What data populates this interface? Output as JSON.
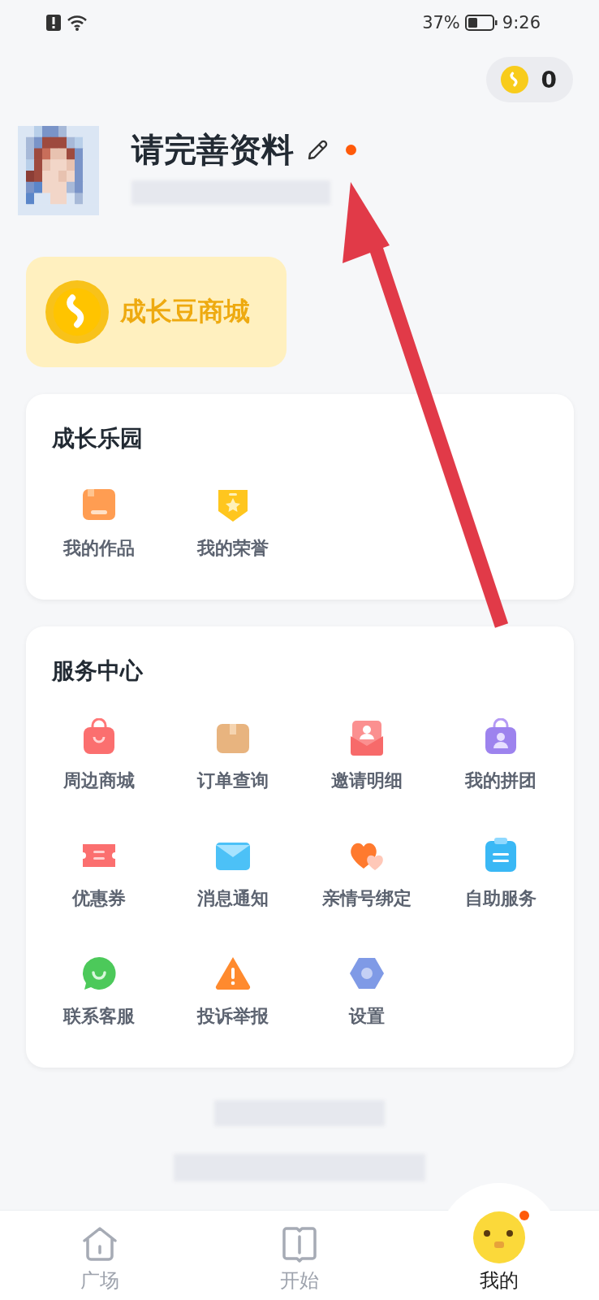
{
  "status_bar": {
    "battery": "37%",
    "time": "9:26"
  },
  "coins": {
    "count": "0"
  },
  "profile": {
    "title": "请完善资料",
    "unread_dot": true
  },
  "mall_card": {
    "label": "成长豆商城"
  },
  "sections": [
    {
      "title": "成长乐园",
      "items": [
        {
          "label": "我的作品"
        },
        {
          "label": "我的荣誉"
        }
      ]
    },
    {
      "title": "服务中心",
      "items": [
        {
          "label": "周边商城"
        },
        {
          "label": "订单查询"
        },
        {
          "label": "邀请明细"
        },
        {
          "label": "我的拼团"
        },
        {
          "label": "优惠券"
        },
        {
          "label": "消息通知"
        },
        {
          "label": "亲情号绑定"
        },
        {
          "label": "自助服务"
        },
        {
          "label": "联系客服"
        },
        {
          "label": "投诉举报"
        },
        {
          "label": "设置"
        }
      ]
    }
  ],
  "bottom_nav": [
    {
      "label": "广场",
      "selected": false,
      "dot": false
    },
    {
      "label": "开始",
      "selected": false,
      "dot": false
    },
    {
      "label": "我的",
      "selected": true,
      "dot": true
    }
  ]
}
